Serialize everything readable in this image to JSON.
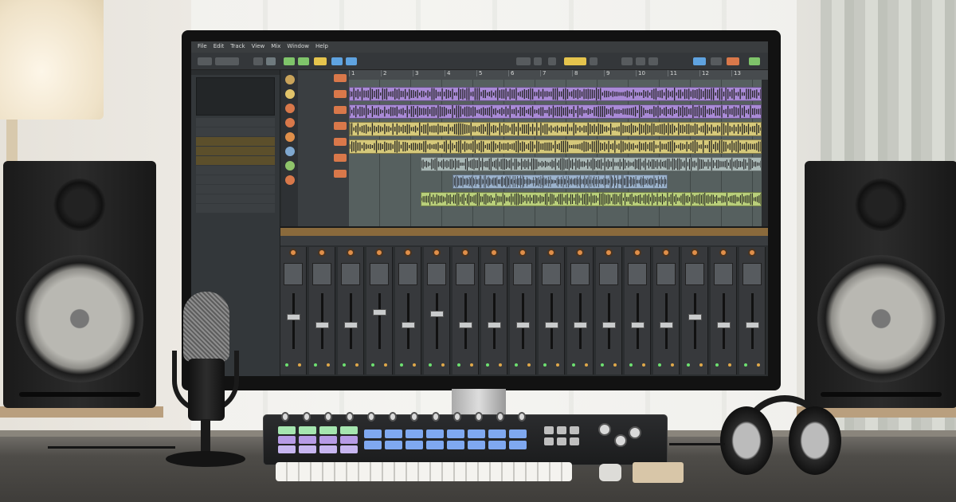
{
  "app": {
    "menu": [
      "File",
      "Edit",
      "Track",
      "View",
      "Mix",
      "Window",
      "Help"
    ],
    "transport_time": "",
    "left_panel": {
      "header": "",
      "rows": [
        "",
        "",
        "",
        "",
        "",
        "",
        "",
        "",
        "",
        ""
      ]
    }
  },
  "ruler_marks": [
    "1",
    "2",
    "3",
    "4",
    "5",
    "6",
    "7",
    "8",
    "9",
    "10",
    "11",
    "12",
    "13"
  ],
  "tracks": [
    {
      "color": "#a98ad6"
    },
    {
      "color": "#a98ad6"
    },
    {
      "color": "#d6c97a"
    },
    {
      "color": "#d6c97a"
    },
    {
      "color": "#a9b8b6"
    },
    {
      "color": "#9bb2cc"
    },
    {
      "color": "#b9cf7a"
    }
  ],
  "mixer": {
    "channels": 17
  },
  "colors": {
    "accent": "#e08f4a",
    "record": "#d9784a",
    "pad_blue": "#7fa8f0",
    "pad_green": "#9fe0a8",
    "pad_purple": "#b79be6"
  }
}
